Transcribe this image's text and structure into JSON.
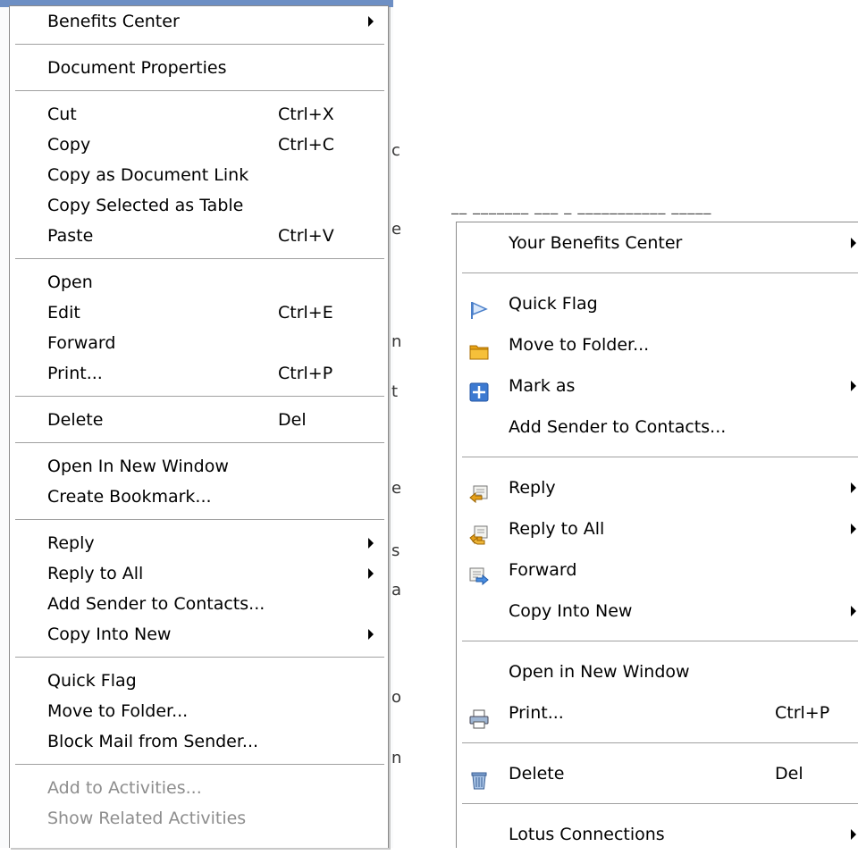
{
  "left_menu": {
    "groups": [
      [
        {
          "label": "Benefits Center",
          "shortcut": "",
          "submenu": true
        }
      ],
      [
        {
          "label": "Document Properties",
          "shortcut": "",
          "submenu": false
        }
      ],
      [
        {
          "label": "Cut",
          "shortcut": "Ctrl+X",
          "submenu": false
        },
        {
          "label": "Copy",
          "shortcut": "Ctrl+C",
          "submenu": false
        },
        {
          "label": "Copy as Document Link",
          "shortcut": "",
          "submenu": false
        },
        {
          "label": "Copy Selected as Table",
          "shortcut": "",
          "submenu": false
        },
        {
          "label": "Paste",
          "shortcut": "Ctrl+V",
          "submenu": false
        }
      ],
      [
        {
          "label": "Open",
          "shortcut": "",
          "submenu": false
        },
        {
          "label": "Edit",
          "shortcut": "Ctrl+E",
          "submenu": false
        },
        {
          "label": "Forward",
          "shortcut": "",
          "submenu": false
        },
        {
          "label": "Print...",
          "shortcut": "Ctrl+P",
          "submenu": false
        }
      ],
      [
        {
          "label": "Delete",
          "shortcut": "Del",
          "submenu": false
        }
      ],
      [
        {
          "label": "Open In New Window",
          "shortcut": "",
          "submenu": false
        },
        {
          "label": "Create Bookmark...",
          "shortcut": "",
          "submenu": false
        }
      ],
      [
        {
          "label": "Reply",
          "shortcut": "",
          "submenu": true
        },
        {
          "label": "Reply to All",
          "shortcut": "",
          "submenu": true
        },
        {
          "label": "Add Sender to Contacts...",
          "shortcut": "",
          "submenu": false
        },
        {
          "label": "Copy Into New",
          "shortcut": "",
          "submenu": true
        }
      ],
      [
        {
          "label": "Quick Flag",
          "shortcut": "",
          "submenu": false
        },
        {
          "label": "Move to Folder...",
          "shortcut": "",
          "submenu": false
        },
        {
          "label": "Block Mail from Sender...",
          "shortcut": "",
          "submenu": false
        }
      ],
      [
        {
          "label": "Add to Activities...",
          "shortcut": "",
          "submenu": false,
          "disabled": true
        },
        {
          "label": "Show Related Activities",
          "shortcut": "",
          "submenu": false,
          "disabled": true
        }
      ]
    ]
  },
  "right_menu": {
    "groups": [
      [
        {
          "label": "Your Benefits Center",
          "shortcut": "",
          "submenu": true,
          "icon": ""
        }
      ],
      [
        {
          "label": "Quick Flag",
          "shortcut": "",
          "submenu": false,
          "icon": "flag-icon"
        },
        {
          "label": "Move to Folder...",
          "shortcut": "",
          "submenu": false,
          "icon": "folder-icon"
        },
        {
          "label": "Mark as",
          "shortcut": "",
          "submenu": true,
          "icon": "mark-as-icon"
        },
        {
          "label": "Add Sender to Contacts...",
          "shortcut": "",
          "submenu": false,
          "icon": ""
        }
      ],
      [
        {
          "label": "Reply",
          "shortcut": "",
          "submenu": true,
          "icon": "reply-icon"
        },
        {
          "label": "Reply to All",
          "shortcut": "",
          "submenu": true,
          "icon": "reply-all-icon"
        },
        {
          "label": "Forward",
          "shortcut": "",
          "submenu": false,
          "icon": "forward-icon"
        },
        {
          "label": "Copy Into New",
          "shortcut": "",
          "submenu": true,
          "icon": ""
        }
      ],
      [
        {
          "label": "Open in New Window",
          "shortcut": "",
          "submenu": false,
          "icon": ""
        },
        {
          "label": "Print...",
          "shortcut": "Ctrl+P",
          "submenu": false,
          "icon": "printer-icon"
        }
      ],
      [
        {
          "label": "Delete",
          "shortcut": "Del",
          "submenu": false,
          "icon": "trash-icon"
        }
      ],
      [
        {
          "label": "Lotus Connections",
          "shortcut": "",
          "submenu": true,
          "icon": ""
        }
      ]
    ]
  }
}
